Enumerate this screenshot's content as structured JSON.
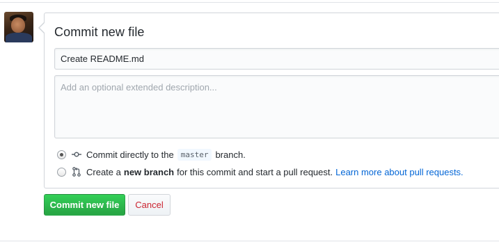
{
  "commit_form": {
    "title": "Commit new file",
    "summary_value": "Create README.md",
    "description_placeholder": "Add an optional extended description...",
    "options": {
      "direct": {
        "selected": true,
        "text_before": "Commit directly to the",
        "branch_name": "master",
        "text_after": "branch.",
        "icon": "git-commit-icon"
      },
      "new_branch": {
        "selected": false,
        "text_before": "Create a",
        "bold_text": "new branch",
        "text_after": "for this commit and start a pull request.",
        "link_text": "Learn more about pull requests.",
        "icon": "git-pull-request-icon"
      }
    },
    "buttons": {
      "commit_label": "Commit new file",
      "cancel_label": "Cancel"
    }
  },
  "colors": {
    "primary_green": "#28a745",
    "cancel_red": "#cb2431",
    "link_blue": "#0366d6",
    "border": "#d1d5da"
  }
}
